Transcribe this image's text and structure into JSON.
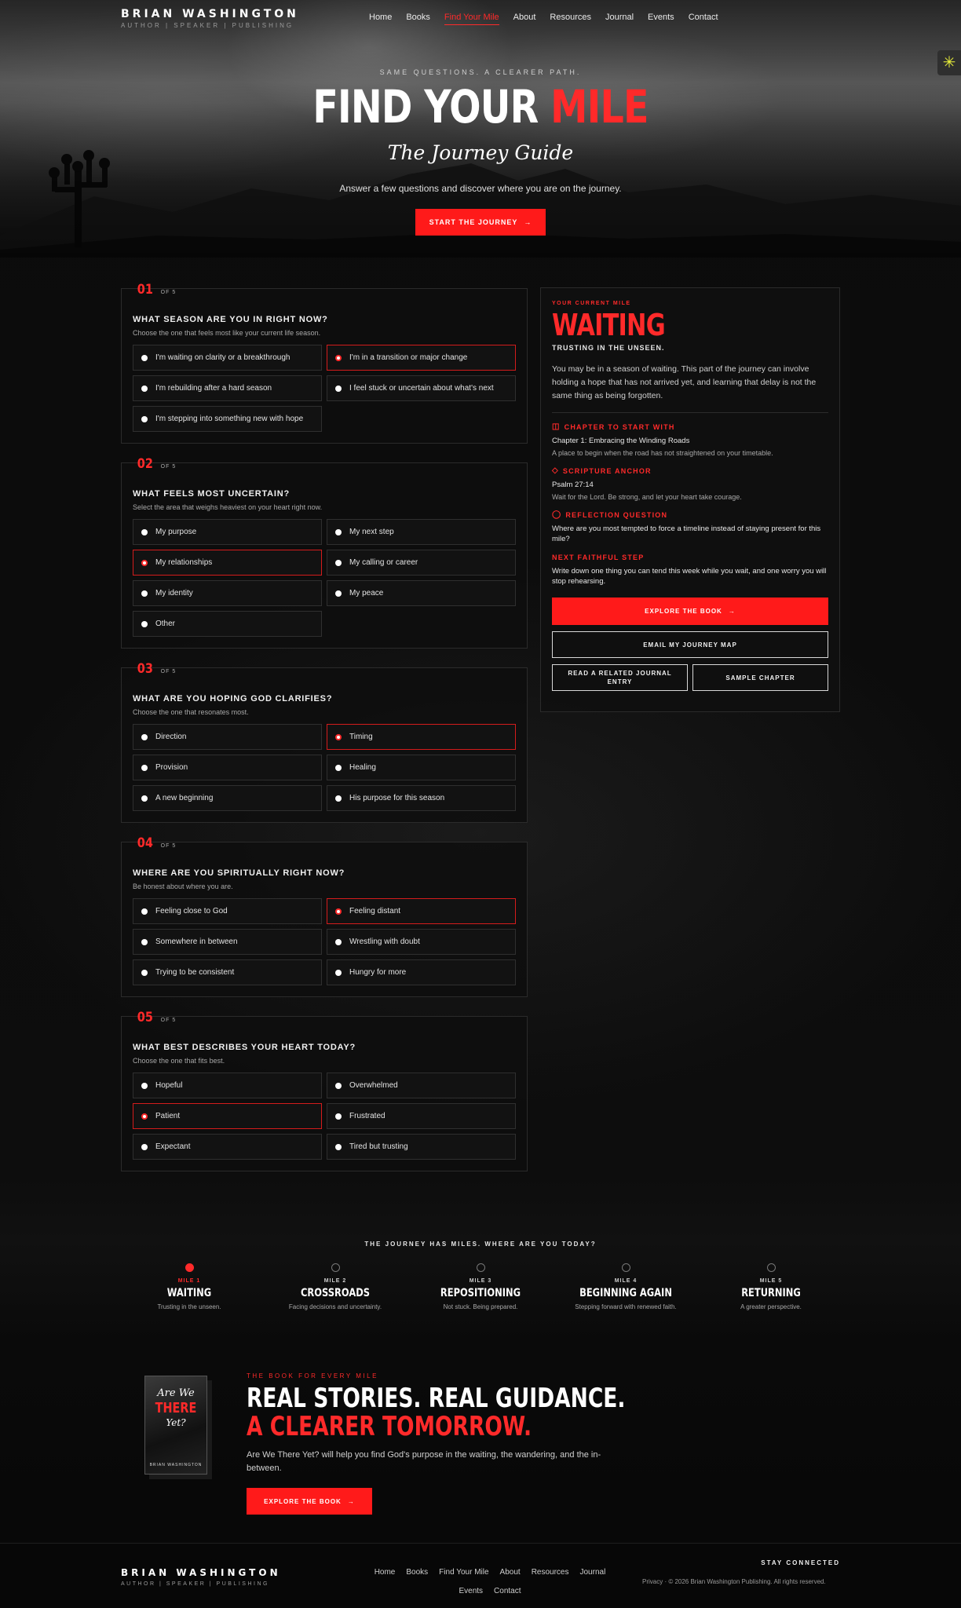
{
  "header": {
    "brand": "BRIAN WASHINGTON",
    "tagline": "AUTHOR | SPEAKER | PUBLISHING",
    "nav": [
      "Home",
      "Books",
      "Find Your Mile",
      "About",
      "Resources",
      "Journal",
      "Events",
      "Contact"
    ],
    "active_nav": "Find Your Mile"
  },
  "hero": {
    "eyebrow": "SAME QUESTIONS. A CLEARER PATH.",
    "title_white": "FIND YOUR",
    "title_red": "MILE",
    "subtitle": "The Journey Guide",
    "lead": "Answer a few questions and discover where you are on the journey.",
    "cta": "START THE JOURNEY"
  },
  "quiz": {
    "of_label": "OF 5",
    "questions": [
      {
        "num": "01",
        "title": "WHAT SEASON ARE YOU IN RIGHT NOW?",
        "sub": "Choose the one that feels most like your current life season.",
        "options": [
          {
            "label": "I'm waiting on clarity or a breakthrough",
            "selected": false
          },
          {
            "label": "I'm in a transition or major change",
            "selected": true
          },
          {
            "label": "I'm rebuilding after a hard season",
            "selected": false
          },
          {
            "label": "I feel stuck or uncertain about what's next",
            "selected": false
          },
          {
            "label": "I'm stepping into something new with hope",
            "selected": false
          }
        ]
      },
      {
        "num": "02",
        "title": "WHAT FEELS MOST UNCERTAIN?",
        "sub": "Select the area that weighs heaviest on your heart right now.",
        "options": [
          {
            "label": "My purpose",
            "selected": false
          },
          {
            "label": "My next step",
            "selected": false
          },
          {
            "label": "My relationships",
            "selected": true
          },
          {
            "label": "My calling or career",
            "selected": false
          },
          {
            "label": "My identity",
            "selected": false
          },
          {
            "label": "My peace",
            "selected": false
          },
          {
            "label": "Other",
            "selected": false
          }
        ]
      },
      {
        "num": "03",
        "title": "WHAT ARE YOU HOPING GOD CLARIFIES?",
        "sub": "Choose the one that resonates most.",
        "options": [
          {
            "label": "Direction",
            "selected": false
          },
          {
            "label": "Timing",
            "selected": true
          },
          {
            "label": "Provision",
            "selected": false
          },
          {
            "label": "Healing",
            "selected": false
          },
          {
            "label": "A new beginning",
            "selected": false
          },
          {
            "label": "His purpose for this season",
            "selected": false
          }
        ]
      },
      {
        "num": "04",
        "title": "WHERE ARE YOU SPIRITUALLY RIGHT NOW?",
        "sub": "Be honest about where you are.",
        "options": [
          {
            "label": "Feeling close to God",
            "selected": false
          },
          {
            "label": "Feeling distant",
            "selected": true
          },
          {
            "label": "Somewhere in between",
            "selected": false
          },
          {
            "label": "Wrestling with doubt",
            "selected": false
          },
          {
            "label": "Trying to be consistent",
            "selected": false
          },
          {
            "label": "Hungry for more",
            "selected": false
          }
        ]
      },
      {
        "num": "05",
        "title": "WHAT BEST DESCRIBES YOUR HEART TODAY?",
        "sub": "Choose the one that fits best.",
        "options": [
          {
            "label": "Hopeful",
            "selected": false
          },
          {
            "label": "Overwhelmed",
            "selected": false
          },
          {
            "label": "Patient",
            "selected": true
          },
          {
            "label": "Frustrated",
            "selected": false
          },
          {
            "label": "Expectant",
            "selected": false
          },
          {
            "label": "Tired but trusting",
            "selected": false
          }
        ]
      }
    ]
  },
  "result": {
    "eyebrow": "YOUR CURRENT MILE",
    "title": "WAITING",
    "sub": "TRUSTING IN THE UNSEEN.",
    "body": "You may be in a season of waiting. This part of the journey can involve holding a hope that has not arrived yet, and learning that delay is not the same thing as being forgotten.",
    "chapter_h": "CHAPTER TO START WITH",
    "chapter_t": "Chapter 1: Embracing the Winding Roads",
    "chapter_m": "A place to begin when the road has not straightened on your timetable.",
    "scripture_h": "SCRIPTURE ANCHOR",
    "scripture_t": "Psalm 27:14",
    "scripture_m": "Wait for the Lord. Be strong, and let your heart take courage.",
    "reflection_h": "REFLECTION QUESTION",
    "reflection_t": "Where are you most tempted to force a timeline instead of staying present for this mile?",
    "step_h": "NEXT FAITHFUL STEP",
    "step_t": "Write down one thing you can tend this week while you wait, and one worry you will stop rehearsing.",
    "btn_explore": "EXPLORE THE BOOK",
    "btn_email": "EMAIL MY JOURNEY MAP",
    "btn_journal": "READ A RELATED JOURNAL ENTRY",
    "btn_sample": "SAMPLE CHAPTER"
  },
  "miles": {
    "heading": "THE JOURNEY HAS MILES. WHERE ARE YOU TODAY?",
    "items": [
      {
        "label": "MILE 1",
        "name": "WAITING",
        "desc": "Trusting in the unseen.",
        "active": true
      },
      {
        "label": "MILE 2",
        "name": "CROSSROADS",
        "desc": "Facing decisions and uncertainty.",
        "active": false
      },
      {
        "label": "MILE 3",
        "name": "REPOSITIONING",
        "desc": "Not stuck. Being prepared.",
        "active": false
      },
      {
        "label": "MILE 4",
        "name": "BEGINNING AGAIN",
        "desc": "Stepping forward with renewed faith.",
        "active": false
      },
      {
        "label": "MILE 5",
        "name": "RETURNING",
        "desc": "A greater perspective.",
        "active": false
      }
    ]
  },
  "book": {
    "cover_l1": "Are We",
    "cover_l2": "THERE",
    "cover_l3": "Yet?",
    "cover_author": "BRIAN WASHINGTON",
    "eyebrow": "THE BOOK FOR EVERY MILE",
    "headline_white": "REAL STORIES. REAL GUIDANCE.",
    "headline_red": "A CLEARER TOMORROW.",
    "body": "Are We There Yet? will help you find God's purpose in the waiting, the wandering, and the in-between.",
    "cta": "EXPLORE THE BOOK"
  },
  "footer": {
    "brand": "BRIAN WASHINGTON",
    "tagline": "AUTHOR | SPEAKER | PUBLISHING",
    "nav": [
      "Home",
      "Books",
      "Find Your Mile",
      "About",
      "Resources",
      "Journal",
      "Events",
      "Contact"
    ],
    "stay": "STAY CONNECTED",
    "copyright": "Privacy · © 2026 Brian Washington Publishing. All rights reserved."
  },
  "colors": {
    "accent": "#ff2a2a",
    "background": "#0a0a0a"
  }
}
